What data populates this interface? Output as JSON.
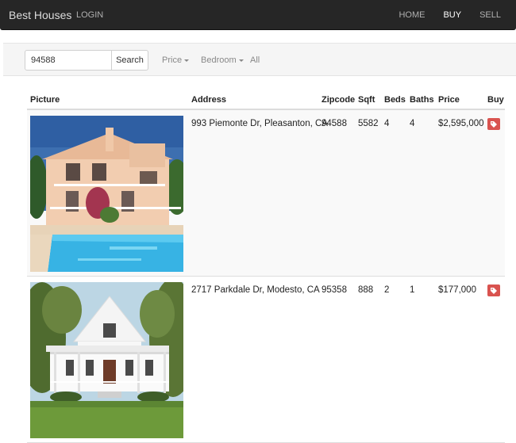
{
  "navbar": {
    "brand": "Best Houses",
    "login": "LOGIN",
    "links": [
      {
        "label": "HOME",
        "active": false
      },
      {
        "label": "BUY",
        "active": true
      },
      {
        "label": "SELL",
        "active": false
      }
    ]
  },
  "filters": {
    "search_value": "94588",
    "search_button": "Search",
    "price_label": "Price",
    "bedroom_label": "Bedroom",
    "all_label": "All"
  },
  "table": {
    "headers": {
      "picture": "Picture",
      "address": "Address",
      "zipcode": "Zipcode",
      "sqft": "Sqft",
      "beds": "Beds",
      "baths": "Baths",
      "price": "Price",
      "buy": "Buy"
    },
    "rows": [
      {
        "address": "993 Piemonte Dr, Pleasanton, CA",
        "zipcode": "94588",
        "sqft": "5582",
        "beds": "4",
        "baths": "4",
        "price": "$2,595,000",
        "buy_icon": "tag-icon"
      },
      {
        "address": "2717 Parkdale Dr, Modesto, CA",
        "zipcode": "95358",
        "sqft": "888",
        "beds": "2",
        "baths": "1",
        "price": "$177,000",
        "buy_icon": "tag-icon"
      }
    ]
  },
  "colors": {
    "navbar_bg": "#262626",
    "buy_button": "#d9534f"
  }
}
